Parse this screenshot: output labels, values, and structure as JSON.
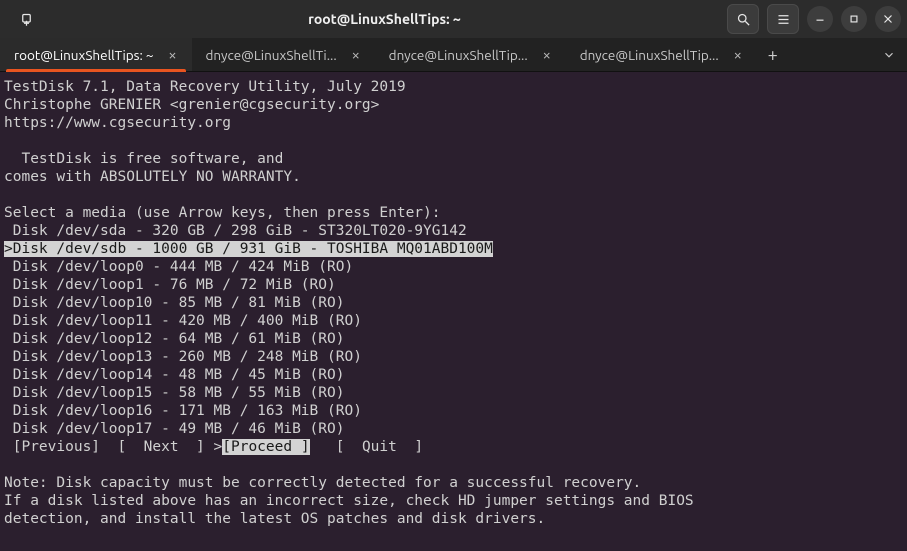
{
  "window": {
    "title": "root@LinuxShellTips: ~"
  },
  "tabs": {
    "items": [
      {
        "label": "root@LinuxShellTips: ~",
        "active": true
      },
      {
        "label": "dnyce@LinuxShellTi...",
        "active": false
      },
      {
        "label": "dnyce@LinuxShellTip...",
        "active": false
      },
      {
        "label": "dnyce@LinuxShellTip...",
        "active": false
      }
    ]
  },
  "app": {
    "header_line1": "TestDisk 7.1, Data Recovery Utility, July 2019",
    "header_line2": "Christophe GRENIER <grenier@cgsecurity.org>",
    "header_line3": "https://www.cgsecurity.org",
    "notice_line1": "  TestDisk is free software, and",
    "notice_line2": "comes with ABSOLUTELY NO WARRANTY.",
    "prompt": "Select a media (use Arrow keys, then press Enter):",
    "disks": [
      " Disk /dev/sda - 320 GB / 298 GiB - ST320LT020-9YG142",
      ">Disk /dev/sdb - 1000 GB / 931 GiB - TOSHIBA MQ01ABD100M",
      " Disk /dev/loop0 - 444 MB / 424 MiB (RO)",
      " Disk /dev/loop1 - 76 MB / 72 MiB (RO)",
      " Disk /dev/loop10 - 85 MB / 81 MiB (RO)",
      " Disk /dev/loop11 - 420 MB / 400 MiB (RO)",
      " Disk /dev/loop12 - 64 MB / 61 MiB (RO)",
      " Disk /dev/loop13 - 260 MB / 248 MiB (RO)",
      " Disk /dev/loop14 - 48 MB / 45 MiB (RO)",
      " Disk /dev/loop15 - 58 MB / 55 MiB (RO)",
      " Disk /dev/loop16 - 171 MB / 163 MiB (RO)",
      " Disk /dev/loop17 - 49 MB / 46 MiB (RO)"
    ],
    "selected_index": 1,
    "menu": {
      "previous_text": " [Previous]  [  Next  ] ",
      "proceed_prefix": ">",
      "proceed_text": "[Proceed ]",
      "quit_text": "   [  Quit  ]"
    },
    "note_line1": "Note: Disk capacity must be correctly detected for a successful recovery.",
    "note_line2": "If a disk listed above has an incorrect size, check HD jumper settings and BIOS",
    "note_line3": "detection, and install the latest OS patches and disk drivers."
  }
}
